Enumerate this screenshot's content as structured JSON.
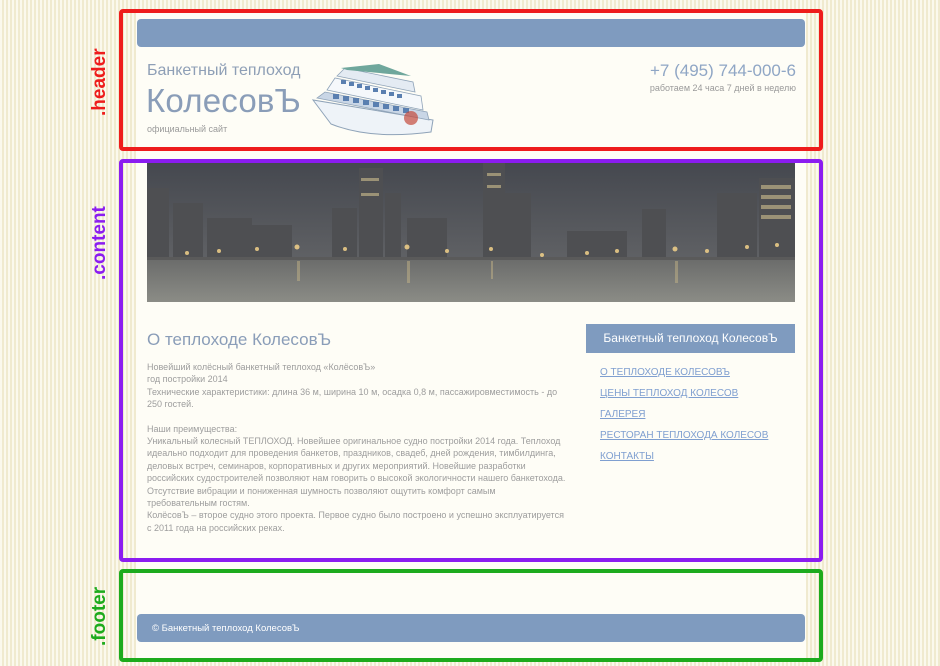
{
  "header": {
    "tagline": "Банкетный теплоход",
    "brand_name": "КолесовЪ",
    "subtitle": "официальный сайт",
    "phone": "+7 (495) 744-000-6",
    "hours": "работаем 24 часа 7 дней в неделю"
  },
  "main": {
    "title": "О теплоходе КолесовЪ",
    "paragraphs": [
      "Новейший колёсный банкетный теплоход «КолёсовЪ»",
      "год постройки 2014",
      "Технические характеристики:  длина 36 м, ширина 10 м, осадка 0,8 м, пассажировместимость - до 250 гостей.",
      "",
      "Наши преимущества:",
      "Уникальный колесный ТЕПЛОХОД. Новейшее оригинальное судно постройки 2014 года. Теплоход идеально подходит для проведения банкетов, праздников, свадеб, дней рождения, тимбилдинга, деловых встреч, семинаров, корпоративных и других мероприятий. Новейшие разработки российских судостроителей позволяют нам говорить о высокой экологичности нашего банкетохода. Отсутствие вибрации и пониженная шумность позволяют ощутить комфорт самым требовательным гостям.",
      "КолёсовЪ – второе судно этого проекта. Первое судно было построено и успешно эксплуатируется с 2011 года на российских реках."
    ]
  },
  "sidebar": {
    "heading": "Банкетный теплоход КолесовЪ",
    "items": [
      {
        "label": "О ТЕПЛОХОДЕ КОЛЕСОВЪ"
      },
      {
        "label": "ЦЕНЫ ТЕПЛОХОД КОЛЕСОВ"
      },
      {
        "label": "ГАЛЕРЕЯ "
      },
      {
        "label": "РЕСТОРАН ТЕПЛОХОДА КОЛЕСОВ"
      },
      {
        "label": "КОНТАКТЫ"
      }
    ]
  },
  "footer": {
    "copyright": "© Банкетный теплоход КолесовЪ"
  },
  "annotations": {
    "header": ".header",
    "content": ".content",
    "footer": ".footer"
  },
  "colors": {
    "accent_bar": "#7f9bbf",
    "header_frame": "#ee1c1c",
    "content_frame": "#8b1cf0",
    "footer_frame": "#1dab1d"
  }
}
